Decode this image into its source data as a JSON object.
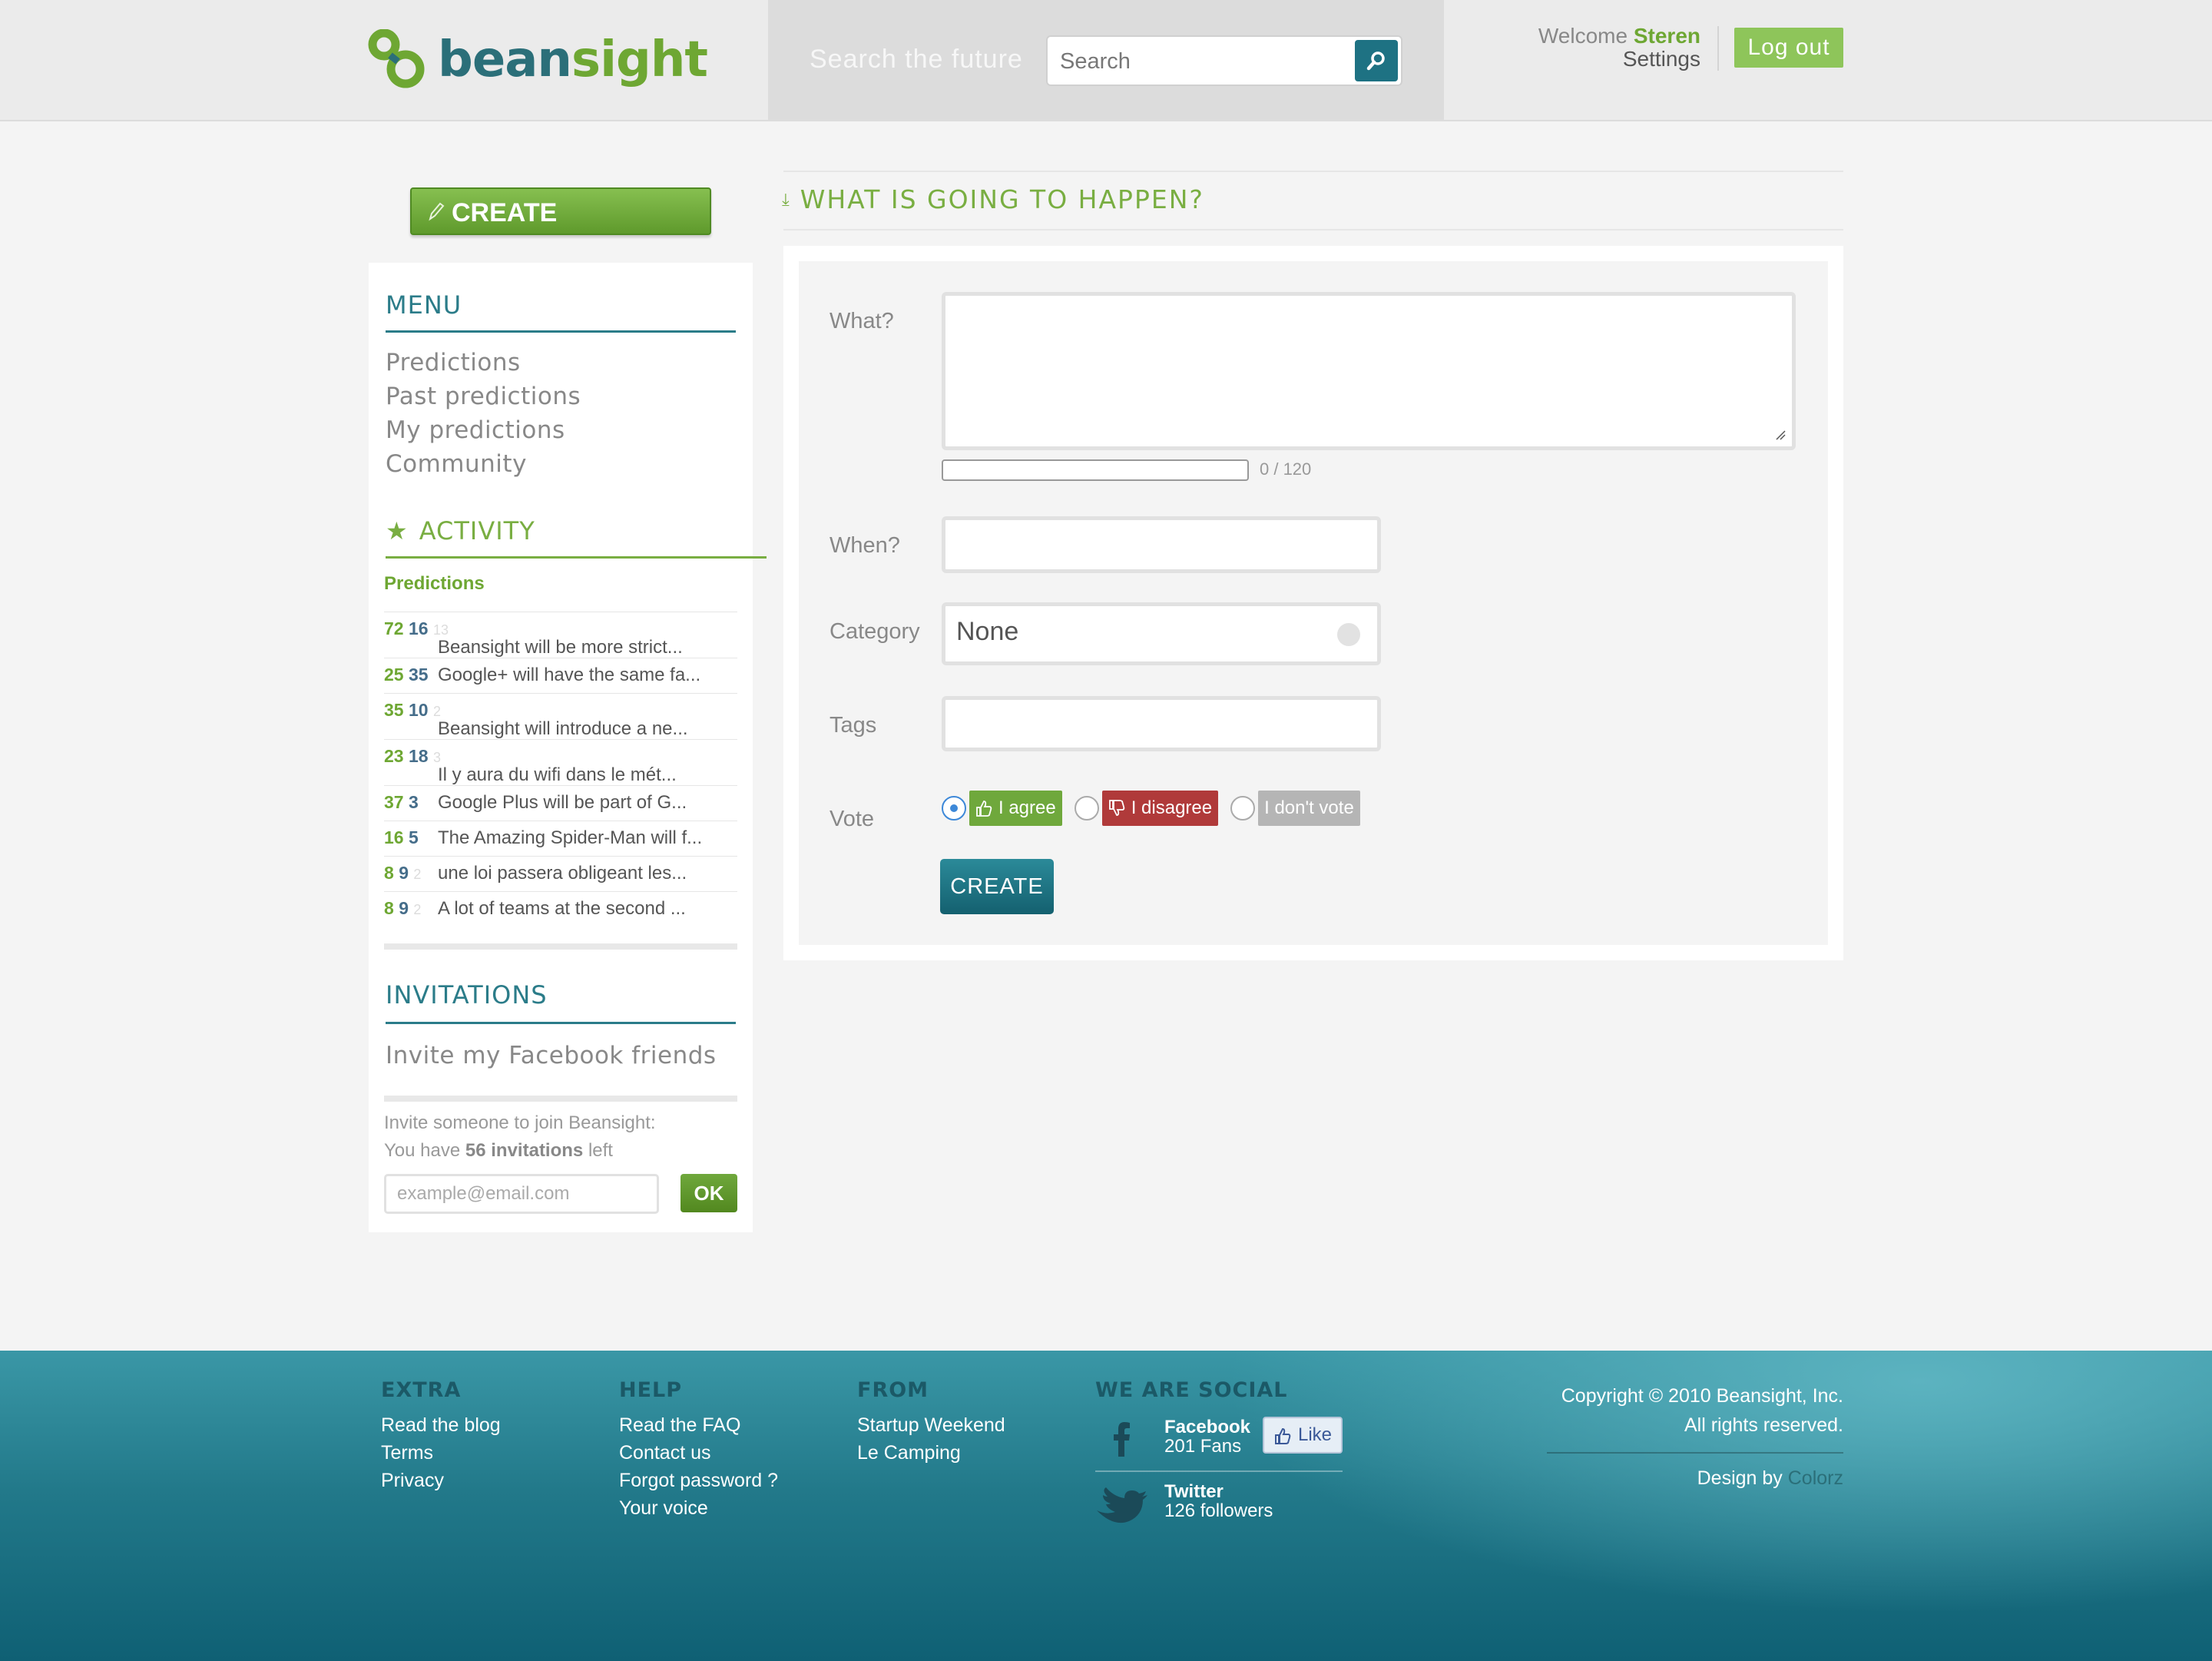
{
  "header": {
    "logo_text_1": "bean",
    "logo_text_2": "sight",
    "search_tagline": "Search the future",
    "search_placeholder": "Search",
    "welcome_prefix": "Welcome",
    "username": "Steren",
    "settings_label": "Settings",
    "logout_label": "Log out"
  },
  "sidebar": {
    "create_label": "CREATE",
    "menu_title": "MENU",
    "menu_items": [
      "Predictions",
      "Past predictions",
      "My predictions",
      "Community"
    ],
    "activity_title": "ACTIVITY",
    "activity_subtitle": "Predictions",
    "activity": [
      {
        "a": "72",
        "b": "16",
        "c": "13",
        "text": "Beansight will be more strict..."
      },
      {
        "a": "25",
        "b": "35",
        "c": "",
        "text": "Google+ will have the same fa..."
      },
      {
        "a": "35",
        "b": "10",
        "c": "2",
        "text": "Beansight will introduce a ne..."
      },
      {
        "a": "23",
        "b": "18",
        "c": "3",
        "text": "Il y aura du wifi dans le mét..."
      },
      {
        "a": "37",
        "b": "3",
        "c": "",
        "text": "Google Plus will be part of G..."
      },
      {
        "a": "16",
        "b": "5",
        "c": "",
        "text": "The Amazing Spider-Man will f..."
      },
      {
        "a": "8",
        "b": "9",
        "c": "2",
        "text": "une loi passera obligeant les..."
      },
      {
        "a": "8",
        "b": "9",
        "c": "2",
        "text": "A lot of teams at the second ..."
      }
    ],
    "invitations_title": "INVITATIONS",
    "invite_facebook": "Invite my Facebook friends",
    "invite_line1": "Invite someone to join Beansight:",
    "invite_have": "You have",
    "invite_count": "56 invitations",
    "invite_left": "left",
    "email_placeholder": "example@email.com",
    "ok_label": "OK"
  },
  "main": {
    "title": "WHAT IS GOING TO HAPPEN?",
    "what_label": "What?",
    "char_count": "0 / 120",
    "when_label": "When?",
    "category_label": "Category",
    "category_value": "None",
    "tags_label": "Tags",
    "vote_label": "Vote",
    "agree_label": "I agree",
    "disagree_label": "I disagree",
    "novote_label": "I don't vote",
    "create_label": "CREATE"
  },
  "footer": {
    "extra_title": "EXTRA",
    "extra_links": [
      "Read the blog",
      "Terms",
      "Privacy"
    ],
    "help_title": "HELP",
    "help_links": [
      "Read the FAQ",
      "Contact us",
      "Forgot password ?",
      "Your voice"
    ],
    "from_title": "FROM",
    "from_links": [
      "Startup Weekend",
      "Le Camping"
    ],
    "social_title": "WE ARE SOCIAL",
    "facebook_name": "Facebook",
    "facebook_count": "201 Fans",
    "like_label": "Like",
    "twitter_name": "Twitter",
    "twitter_count": "126 followers",
    "copyright_1": "Copyright © 2010 Beansight, Inc.",
    "copyright_2": "All rights reserved.",
    "design_prefix": "Design by",
    "design_by": "Colorz"
  },
  "colors": {
    "brand_green": "#6ea733",
    "brand_teal": "#2b7c89",
    "agree": "#6fa83c",
    "disagree": "#b03a3a",
    "novote": "#b5b5b5"
  }
}
